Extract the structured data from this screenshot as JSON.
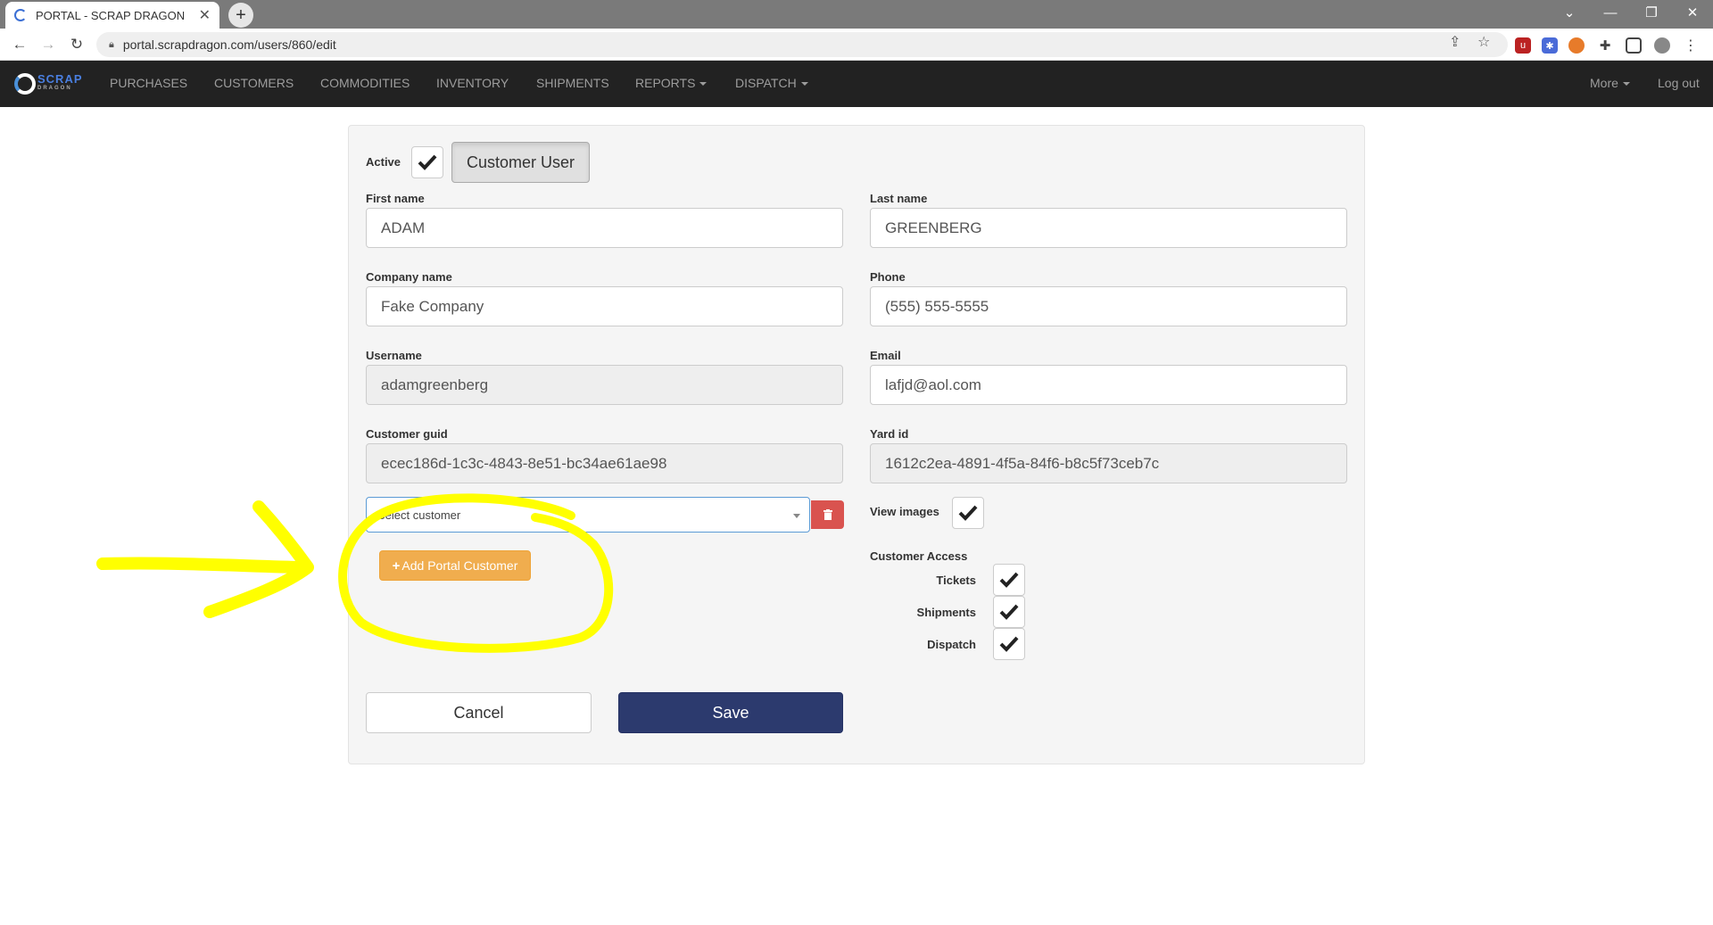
{
  "browser": {
    "tab_title": "PORTAL - SCRAP DRAGON",
    "tab_close": "✕",
    "new_tab": "+",
    "url": "portal.scrapdragon.com/users/860/edit"
  },
  "app": {
    "logo_text": "SCRAP",
    "logo_sub": "DRAGON",
    "nav": {
      "purchases": "PURCHASES",
      "customers": "CUSTOMERS",
      "commodities": "COMMODITIES",
      "inventory": "INVENTORY",
      "shipments": "SHIPMENTS",
      "reports": "REPORTS",
      "dispatch": "DISPATCH",
      "more": "More",
      "logout": "Log out"
    }
  },
  "form": {
    "active_label": "Active",
    "active_checked": true,
    "role_button": "Customer User",
    "first_name": {
      "label": "First name",
      "value": "ADAM"
    },
    "last_name": {
      "label": "Last name",
      "value": "GREENBERG"
    },
    "company_name": {
      "label": "Company name",
      "value": "Fake Company"
    },
    "phone": {
      "label": "Phone",
      "value": "(555) 555-5555"
    },
    "username": {
      "label": "Username",
      "value": "adamgreenberg"
    },
    "email": {
      "label": "Email",
      "value": "lafjd@aol.com"
    },
    "customer_guid": {
      "label": "Customer guid",
      "value": "ecec186d-1c3c-4843-8e51-bc34ae61ae98"
    },
    "yard_id": {
      "label": "Yard id",
      "value": "1612c2ea-4891-4f5a-84f6-b8c5f73ceb7c"
    },
    "select_customer_placeholder": "Select customer",
    "view_images_label": "View images",
    "add_portal_customer": "Add Portal Customer",
    "customer_access_label": "Customer Access",
    "access": {
      "tickets": "Tickets",
      "shipments": "Shipments",
      "dispatch": "Dispatch"
    },
    "cancel": "Cancel",
    "save": "Save"
  },
  "colors": {
    "navbar_bg": "#222222",
    "save_bg": "#2c3a6e",
    "add_btn_bg": "#f0ad4e",
    "delete_btn_bg": "#d9534f",
    "annotation": "#ffff00"
  }
}
